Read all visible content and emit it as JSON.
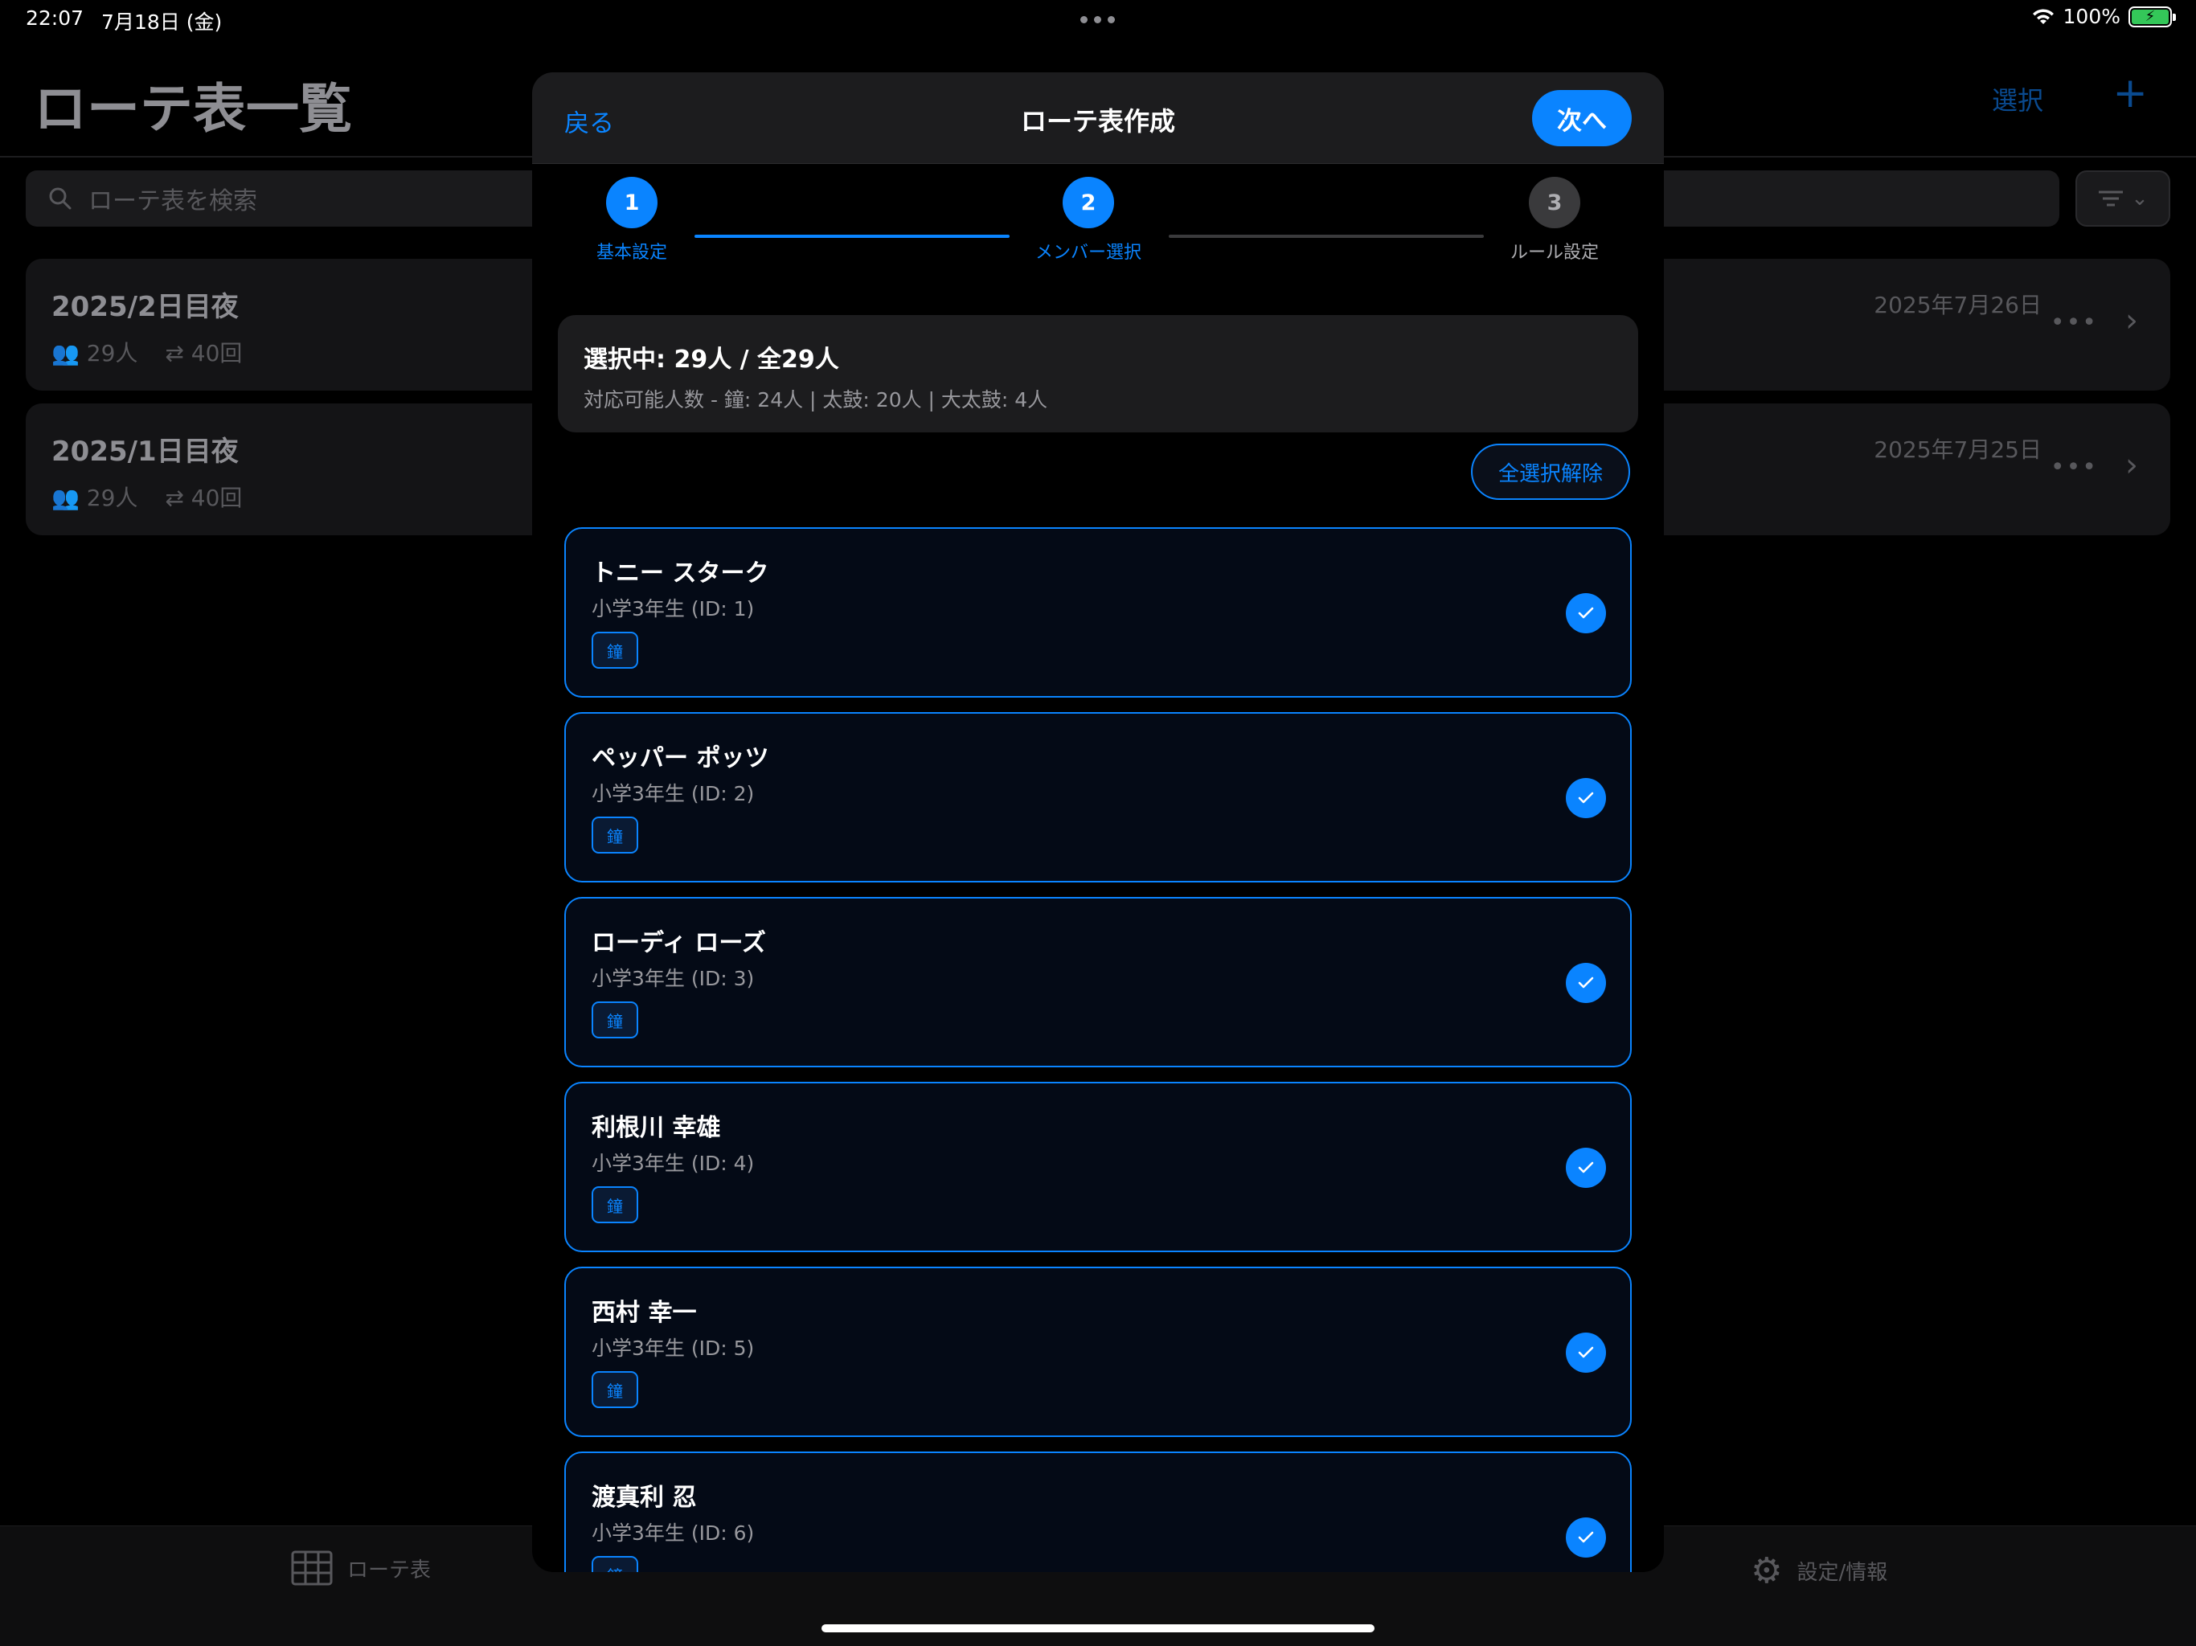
{
  "status_bar": {
    "time": "22:07",
    "date": "7月18日 (金)",
    "battery": "100%"
  },
  "background": {
    "title": "ローテ表一覧",
    "select_label": "選択",
    "add_icon": "plus-icon",
    "search_placeholder": "ローテ表を検索",
    "cards": [
      {
        "title": "2025/2日目夜",
        "members": "29人",
        "rounds": "40回",
        "date": "2025年7月26日"
      },
      {
        "title": "2025/1日目夜",
        "members": "29人",
        "rounds": "40回",
        "date": "2025年7月25日"
      }
    ],
    "tabs": [
      {
        "label": "ローテ表",
        "icon": "table-icon"
      },
      {
        "label": "設定/情報",
        "icon": "gear-icon"
      }
    ]
  },
  "modal": {
    "back_label": "戻る",
    "title": "ローテ表作成",
    "next_label": "次へ",
    "steps": [
      {
        "number": "1",
        "label": "基本設定",
        "state": "done"
      },
      {
        "number": "2",
        "label": "メンバー選択",
        "state": "active"
      },
      {
        "number": "3",
        "label": "ルール設定",
        "state": "todo"
      }
    ],
    "summary": {
      "title": "選択中: 29人 / 全29人",
      "detail": "対応可能人数 - 鐘: 24人 | 太鼓: 20人 | 大太鼓: 4人"
    },
    "deselect_label": "全選択解除",
    "members": [
      {
        "name": "トニー スターク",
        "sub": "小学3年生 (ID: 1)",
        "tag": "鐘",
        "selected": true
      },
      {
        "name": "ペッパー ポッツ",
        "sub": "小学3年生 (ID: 2)",
        "tag": "鐘",
        "selected": true
      },
      {
        "name": "ローディ ローズ",
        "sub": "小学3年生 (ID: 3)",
        "tag": "鐘",
        "selected": true
      },
      {
        "name": "利根川 幸雄",
        "sub": "小学3年生 (ID: 4)",
        "tag": "鐘",
        "selected": true
      },
      {
        "name": "西村 幸一",
        "sub": "小学3年生 (ID: 5)",
        "tag": "鐘",
        "selected": true
      },
      {
        "name": "渡真利 忍",
        "sub": "小学3年生 (ID: 6)",
        "tag": "鐘",
        "selected": true
      }
    ]
  },
  "colors": {
    "accent": "#0a84ff",
    "card_bg": "#040a16",
    "modal_header": "#1c1c1e"
  }
}
